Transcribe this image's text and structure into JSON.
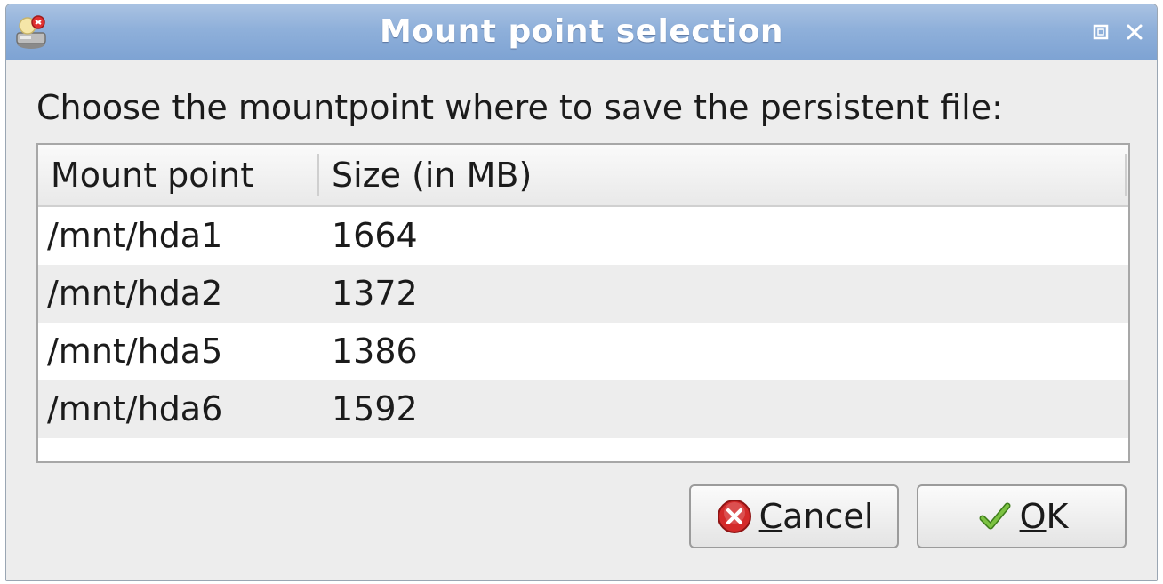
{
  "window": {
    "title": "Mount point selection"
  },
  "prompt": "Choose the mountpoint where to save the persistent file:",
  "table": {
    "columns": [
      "Mount point",
      "Size (in MB)"
    ],
    "rows": [
      {
        "mount": "/mnt/hda1",
        "size": "1664"
      },
      {
        "mount": "/mnt/hda2",
        "size": "1372"
      },
      {
        "mount": "/mnt/hda5",
        "size": "1386"
      },
      {
        "mount": "/mnt/hda6",
        "size": "1592"
      }
    ]
  },
  "buttons": {
    "cancel_label": "Cancel",
    "ok_label": "OK"
  },
  "icons": {
    "app": "drive-icon",
    "maximize": "maximize-icon",
    "close": "close-icon",
    "cancel": "cancel-icon",
    "ok": "checkmark-icon"
  },
  "colors": {
    "titlebar": "#8fb0da",
    "cancel_icon": "#d42a2a",
    "ok_icon": "#5aa02c"
  }
}
